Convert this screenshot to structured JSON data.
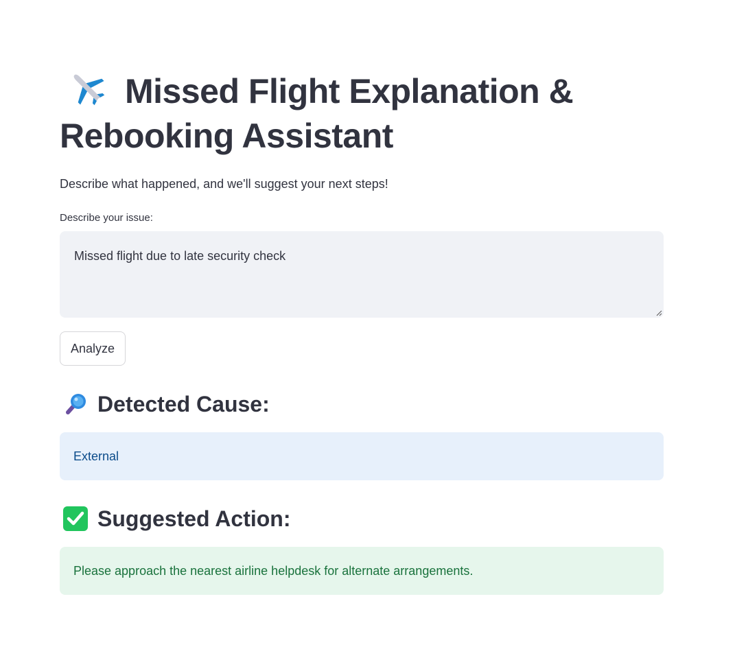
{
  "header": {
    "icon": "airplane-icon",
    "title": "Missed Flight Explanation & Rebooking Assistant",
    "subtitle": "Describe what happened, and we'll suggest your next steps!"
  },
  "form": {
    "label": "Describe your issue:",
    "value": "Missed flight due to late security check",
    "button_label": "Analyze"
  },
  "cause": {
    "icon": "magnifier-icon",
    "heading": "Detected Cause:",
    "value": "External"
  },
  "action": {
    "icon": "check-box-icon",
    "heading": "Suggested Action:",
    "value": "Please approach the nearest airline helpdesk for alternate arrangements."
  },
  "colors": {
    "text": "#31333f",
    "textarea_bg": "#f0f2f6",
    "info_bg": "#e7f0fb",
    "info_text": "#0b4b8a",
    "success_bg": "#e6f6ec",
    "success_text": "#19723c",
    "check_green": "#21c55d"
  }
}
